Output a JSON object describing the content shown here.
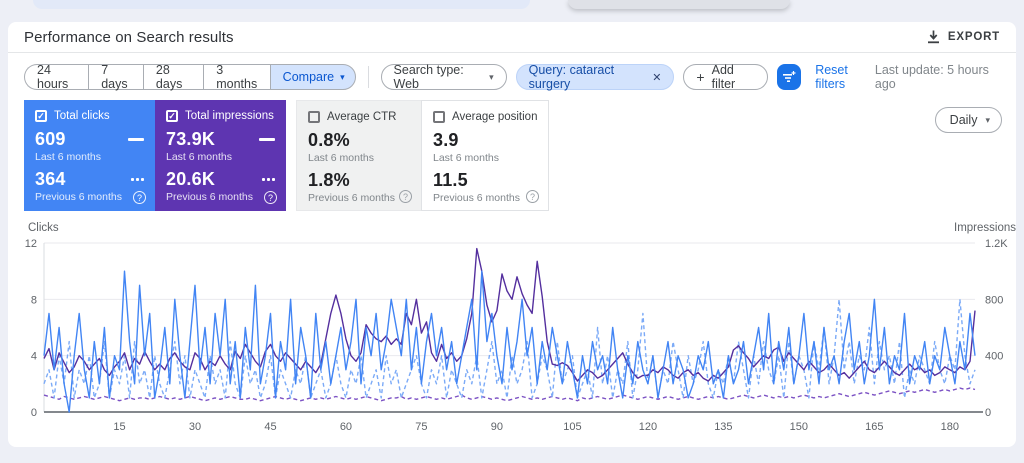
{
  "header": {
    "title": "Performance on Search results",
    "export_label": "EXPORT"
  },
  "filters": {
    "date_buttons": [
      "24 hours",
      "7 days",
      "28 days",
      "3 months"
    ],
    "compare_label": "Compare",
    "search_type_chip": "Search type: Web",
    "query_chip": "Query: cataract surgery",
    "add_filter_label": "Add filter",
    "reset_label": "Reset filters",
    "last_update": "Last update: 5 hours ago"
  },
  "icons": {
    "caret": "▾",
    "close": "✕",
    "plus": "+",
    "check": "✓",
    "help": "?"
  },
  "colors": {
    "clicks_card": "#4285f4",
    "impressions_card": "#5e35b1",
    "accent_blue": "#1a73e8",
    "chip_blue_bg": "#d3e3fd",
    "clicks_line": "#4285f4",
    "clicks_prev_line": "#7baaf7",
    "impressions_line": "#542f9e",
    "impressions_prev_line": "#7c52c4"
  },
  "cards": [
    {
      "label": "Total clicks",
      "selected": true,
      "value1": "609",
      "caption1": "Last 6 months",
      "value2": "364",
      "caption2": "Previous 6 months"
    },
    {
      "label": "Total impressions",
      "selected": true,
      "value1": "73.9K",
      "caption1": "Last 6 months",
      "value2": "20.6K",
      "caption2": "Previous 6 months"
    },
    {
      "label": "Average CTR",
      "selected": false,
      "value1": "0.8%",
      "caption1": "Last 6 months",
      "value2": "1.8%",
      "caption2": "Previous 6 months"
    },
    {
      "label": "Average position",
      "selected": false,
      "value1": "3.9",
      "caption1": "Last 6 months",
      "value2": "11.5",
      "caption2": "Previous 6 months"
    }
  ],
  "granularity": {
    "label": "Daily"
  },
  "chart_data": {
    "type": "line",
    "left_axis": {
      "label": "Clicks",
      "max": 12,
      "ticks": [
        0,
        4,
        8,
        12
      ],
      "tick_labels": [
        "0",
        "4",
        "8",
        "12"
      ]
    },
    "right_axis": {
      "label": "Impressions",
      "max": 1200,
      "ticks": [
        0,
        400,
        800,
        1200
      ],
      "tick_labels": [
        "0",
        "400",
        "800",
        "1.2K"
      ]
    },
    "x_ticks": [
      15,
      30,
      45,
      60,
      75,
      90,
      105,
      120,
      135,
      150,
      165,
      180
    ],
    "x_days": 185,
    "grid": true,
    "series": [
      {
        "name": "Clicks - last 6 months",
        "axis": "left",
        "style": "solid",
        "color": "#4285f4",
        "values": [
          4,
          7,
          3,
          6,
          2,
          0,
          4,
          7,
          3,
          1,
          5,
          2,
          6,
          1,
          4,
          3,
          10,
          5,
          2,
          9,
          4,
          7,
          1,
          3,
          6,
          2,
          8,
          4,
          1,
          5,
          9,
          3,
          6,
          2,
          7,
          4,
          8,
          2,
          5,
          1,
          6,
          3,
          9,
          2,
          4,
          7,
          1,
          5,
          3,
          8,
          2,
          6,
          4,
          1,
          7,
          3,
          5,
          2,
          4,
          6,
          3,
          5,
          8,
          2,
          6,
          4,
          7,
          3,
          5,
          8,
          6,
          4,
          8,
          3,
          6,
          2,
          5,
          7,
          4,
          6,
          3,
          5,
          2,
          4,
          6,
          8,
          3,
          10,
          5,
          7,
          4,
          2,
          6,
          3,
          5,
          8,
          4,
          6,
          2,
          5,
          3,
          6,
          4,
          2,
          5,
          3,
          1,
          4,
          2,
          5,
          3,
          4,
          2,
          6,
          3,
          1,
          4,
          2,
          5,
          3,
          2,
          4,
          1,
          3,
          5,
          2,
          4,
          3,
          1,
          2,
          4,
          3,
          5,
          2,
          3,
          1,
          4,
          2,
          3,
          5,
          2,
          4,
          6,
          3,
          7,
          2,
          5,
          3,
          6,
          2,
          4,
          7,
          3,
          5,
          2,
          6,
          3,
          4,
          2,
          5,
          7,
          3,
          5,
          2,
          4,
          8,
          3,
          6,
          2,
          4,
          3,
          7,
          2,
          4,
          3,
          5,
          2,
          4,
          3,
          6,
          4,
          2,
          5,
          3,
          7,
          4
        ]
      },
      {
        "name": "Clicks - previous 6 months",
        "axis": "left",
        "style": "dashed",
        "color": "#7baaf7",
        "values": [
          2,
          3,
          1,
          4,
          2,
          5,
          1,
          3,
          2,
          4,
          1,
          2,
          5,
          1,
          3,
          2,
          4,
          1,
          5,
          2,
          3,
          1,
          4,
          2,
          1,
          3,
          5,
          2,
          4,
          1,
          3,
          2,
          1,
          4,
          2,
          3,
          1,
          5,
          2,
          1,
          4,
          2,
          3,
          1,
          2,
          4,
          1,
          3,
          2,
          1,
          3,
          2,
          4,
          1,
          2,
          3,
          1,
          2,
          4,
          2,
          1,
          3,
          2,
          4,
          1,
          2,
          3,
          1,
          4,
          2,
          3,
          1,
          2,
          3,
          4,
          2,
          1,
          3,
          2,
          4,
          1,
          3,
          2,
          1,
          3,
          2,
          4,
          1,
          3,
          5,
          2,
          3,
          1,
          4,
          2,
          3,
          5,
          1,
          2,
          4,
          3,
          1,
          5,
          2,
          3,
          4,
          1,
          2,
          3,
          1,
          6,
          2,
          4,
          1,
          3,
          2,
          5,
          1,
          3,
          7,
          2,
          4,
          1,
          3,
          2,
          5,
          3,
          1,
          4,
          2,
          3,
          5,
          2,
          1,
          3,
          2,
          4,
          2,
          5,
          3,
          1,
          4,
          2,
          5,
          3,
          2,
          4,
          1,
          5,
          2,
          4,
          3,
          1,
          5,
          3,
          6,
          2,
          4,
          8,
          3,
          5,
          2,
          4,
          3,
          6,
          2,
          5,
          3,
          4,
          2,
          5,
          1,
          3,
          2,
          4,
          3,
          2,
          5,
          3,
          2,
          4,
          3,
          8,
          4,
          2,
          3
        ]
      },
      {
        "name": "Impressions - last 6 months",
        "axis": "right",
        "style": "solid",
        "color": "#542f9e",
        "values": [
          380,
          450,
          300,
          420,
          350,
          280,
          320,
          400,
          360,
          300,
          340,
          380,
          300,
          260,
          320,
          360,
          420,
          300,
          380,
          340,
          430,
          360,
          300,
          340,
          300,
          380,
          420,
          360,
          320,
          300,
          420,
          380,
          300,
          360,
          330,
          400,
          340,
          300,
          430,
          380,
          480,
          420,
          360,
          320,
          430,
          480,
          400,
          360,
          420,
          380,
          340,
          300,
          360,
          320,
          280,
          340,
          520,
          700,
          830,
          700,
          520,
          400,
          360,
          420,
          620,
          560,
          520,
          500,
          540,
          480,
          520,
          480,
          700,
          620,
          800,
          560,
          640,
          420,
          360,
          480,
          380,
          420,
          360,
          400,
          520,
          700,
          1160,
          1000,
          760,
          640,
          720,
          980,
          860,
          800,
          960,
          840,
          760,
          700,
          1070,
          820,
          500,
          340,
          330,
          350,
          330,
          280,
          220,
          260,
          300,
          280,
          240,
          260,
          300,
          340,
          380,
          420,
          340,
          280,
          240,
          260,
          260,
          300,
          280,
          320,
          300,
          260,
          240,
          280,
          300,
          260,
          280,
          240,
          220,
          260,
          240,
          280,
          320,
          440,
          470,
          420,
          380,
          320,
          360,
          400,
          380,
          440,
          460,
          360,
          420,
          380,
          340,
          300,
          360,
          320,
          280,
          300,
          340,
          300,
          260,
          280,
          240,
          280,
          320,
          360,
          300,
          280,
          320,
          360,
          320,
          280,
          260,
          300,
          340,
          300,
          320,
          280,
          300,
          260,
          280,
          320,
          300,
          280,
          320,
          300,
          360,
          720
        ]
      },
      {
        "name": "Impressions - previous 6 months",
        "axis": "right",
        "style": "dashed",
        "color": "#7c52c4",
        "values": [
          120,
          110,
          100,
          90,
          110,
          100,
          90,
          100,
          110,
          100,
          90,
          100,
          110,
          100,
          90,
          80,
          90,
          100,
          90,
          100,
          100,
          90,
          100,
          110,
          100,
          90,
          100,
          90,
          100,
          110,
          100,
          90,
          80,
          90,
          100,
          90,
          100,
          110,
          100,
          90,
          90,
          100,
          90,
          80,
          90,
          100,
          110,
          100,
          90,
          100,
          90,
          80,
          90,
          100,
          90,
          100,
          90,
          100,
          110,
          100,
          90,
          100,
          90,
          100,
          110,
          100,
          90,
          80,
          90,
          100,
          100,
          110,
          90,
          100,
          90,
          100,
          110,
          100,
          90,
          100,
          90,
          100,
          110,
          120,
          100,
          90,
          100,
          110,
          100,
          90,
          100,
          90,
          80,
          90,
          100,
          110,
          100,
          90,
          100,
          90,
          100,
          110,
          100,
          90,
          100,
          90,
          80,
          100,
          90,
          100,
          110,
          100,
          90,
          100,
          110,
          120,
          110,
          100,
          90,
          100,
          110,
          100,
          90,
          100,
          110,
          100,
          90,
          100,
          110,
          100,
          90,
          100,
          110,
          100,
          110,
          100,
          90,
          100,
          110,
          120,
          110,
          100,
          110,
          120,
          110,
          100,
          110,
          100,
          110,
          100,
          110,
          120,
          110,
          100,
          110,
          100,
          110,
          120,
          130,
          120,
          110,
          120,
          130,
          140,
          130,
          120,
          130,
          140,
          150,
          140,
          130,
          140,
          150,
          140,
          150,
          160,
          150,
          140,
          150,
          160,
          150,
          160,
          170,
          160,
          170,
          160
        ]
      }
    ]
  }
}
